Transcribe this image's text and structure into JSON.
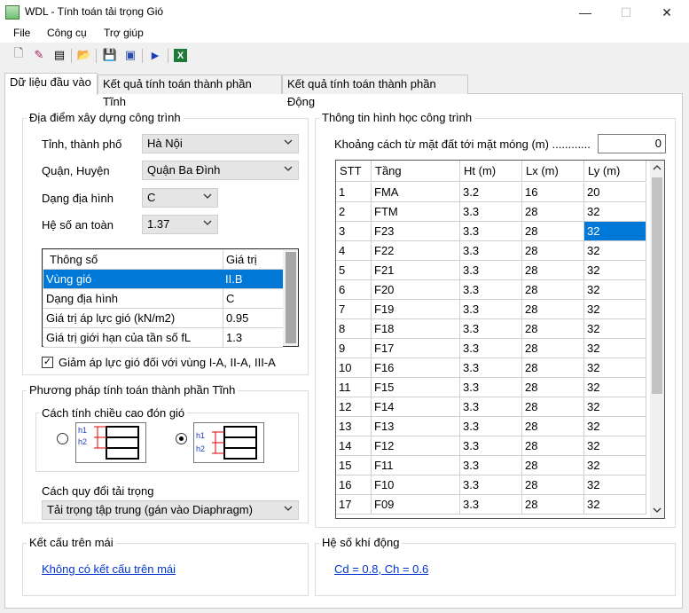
{
  "window": {
    "title": "WDL - Tính toán tải trọng Gió",
    "min_glyph": "—",
    "max_glyph": "☐",
    "close_glyph": "✕"
  },
  "menu": [
    "File",
    "Công cụ",
    "Trợ giúp"
  ],
  "toolbar": {
    "icons": [
      "new-file-icon",
      "edit-icon",
      "film-icon",
      "open-folder-icon",
      "save-icon",
      "save-all-icon",
      "run-icon",
      "excel-icon"
    ],
    "glyphs": [
      "🗋",
      "✎",
      "▤",
      "📂",
      "💾",
      "▣",
      "▶",
      "X"
    ]
  },
  "tabs": [
    "Dữ liệu đầu vào",
    "Kết quả tính toán thành phần Tĩnh",
    "Kết quả tính toán thành phần Động"
  ],
  "location": {
    "group_title": "Địa điểm xây dựng công trình",
    "province_label": "Tỉnh, thành phố",
    "province_value": "Hà Nội",
    "district_label": "Quận, Huyện",
    "district_value": "Quận Ba Đình",
    "terrain_label": "Dạng địa hình",
    "terrain_value": "C",
    "safety_label": "Hệ số an toàn",
    "safety_value": "1.37",
    "param_table": {
      "headers": [
        "Thông số",
        "Giá trị"
      ],
      "rows": [
        [
          "Vùng gió",
          "II.B"
        ],
        [
          "Dạng địa hình",
          "C"
        ],
        [
          "Giá trị áp lực gió (kN/m2)",
          "0.95"
        ],
        [
          "Giá trị giới hạn của tần số fL",
          "1.3"
        ]
      ],
      "selected_row": 0
    },
    "reduce_checkbox_label": "Giảm áp lực gió đối với vùng I-A, II-A, III-A",
    "reduce_checked": true
  },
  "static_method": {
    "group_title": "Phương pháp tính toán thành phần Tĩnh",
    "height_group_title": "Cách tính chiều cao đón gió",
    "h1": "h1",
    "h2": "h2",
    "selected_option": 1,
    "load_label": "Cách quy đổi tải trọng",
    "load_value": "Tải trọng tập trung (gán vào Diaphragm)"
  },
  "roof": {
    "group_title": "Kết cấu trên mái",
    "link": "Không có kết cấu trên mái"
  },
  "geometry": {
    "group_title": "Thông tin hình học công trình",
    "distance_label": "Khoảng cách từ mặt đất tới mặt móng (m) ............",
    "distance_value": "0",
    "headers": [
      "STT",
      "Tầng",
      "Ht (m)",
      "Lx (m)",
      "Ly (m)"
    ],
    "rows": [
      [
        "1",
        "FMA",
        "3.2",
        "16",
        "20"
      ],
      [
        "2",
        "FTM",
        "3.3",
        "28",
        "32"
      ],
      [
        "3",
        "F23",
        "3.3",
        "28",
        "32"
      ],
      [
        "4",
        "F22",
        "3.3",
        "28",
        "32"
      ],
      [
        "5",
        "F21",
        "3.3",
        "28",
        "32"
      ],
      [
        "6",
        "F20",
        "3.3",
        "28",
        "32"
      ],
      [
        "7",
        "F19",
        "3.3",
        "28",
        "32"
      ],
      [
        "8",
        "F18",
        "3.3",
        "28",
        "32"
      ],
      [
        "9",
        "F17",
        "3.3",
        "28",
        "32"
      ],
      [
        "10",
        "F16",
        "3.3",
        "28",
        "32"
      ],
      [
        "11",
        "F15",
        "3.3",
        "28",
        "32"
      ],
      [
        "12",
        "F14",
        "3.3",
        "28",
        "32"
      ],
      [
        "13",
        "F13",
        "3.3",
        "28",
        "32"
      ],
      [
        "14",
        "F12",
        "3.3",
        "28",
        "32"
      ],
      [
        "15",
        "F11",
        "3.3",
        "28",
        "32"
      ],
      [
        "16",
        "F10",
        "3.3",
        "28",
        "32"
      ],
      [
        "17",
        "F09",
        "3.3",
        "28",
        "32"
      ]
    ],
    "selected_cell": [
      2,
      4
    ]
  },
  "aero": {
    "group_title": "Hệ số khí động",
    "link": "Cd = 0.8, Ch = 0.6"
  },
  "colors": {
    "selection": "#0078d7",
    "link": "#0033cc",
    "background": "#f0f0f0"
  }
}
